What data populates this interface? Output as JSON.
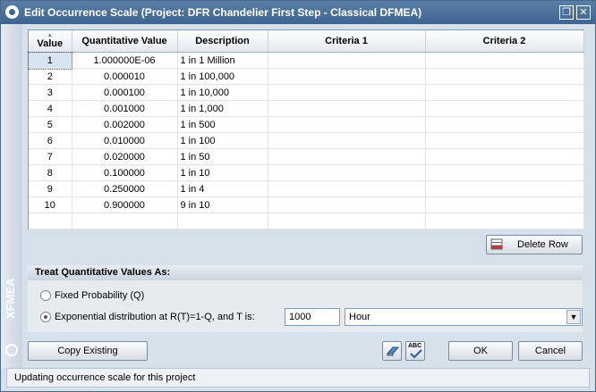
{
  "window": {
    "title": "Edit Occurrence Scale (Project: DFR Chandelier First Step - Classical DFMEA)",
    "restore_glyph": "❐",
    "close_glyph": "✕"
  },
  "sidebar": {
    "brand": "XFMEA"
  },
  "grid": {
    "columns": [
      "Value",
      "Quantitative Value",
      "Description",
      "Criteria 1",
      "Criteria 2"
    ],
    "rows": [
      {
        "value": "1",
        "quant": "1.000000E-06",
        "desc": "1 in 1 Million",
        "c1": "",
        "c2": ""
      },
      {
        "value": "2",
        "quant": "0.000010",
        "desc": "1 in 100,000",
        "c1": "",
        "c2": ""
      },
      {
        "value": "3",
        "quant": "0.000100",
        "desc": "1 in 10,000",
        "c1": "",
        "c2": ""
      },
      {
        "value": "4",
        "quant": "0.001000",
        "desc": "1 in 1,000",
        "c1": "",
        "c2": ""
      },
      {
        "value": "5",
        "quant": "0.002000",
        "desc": "1 in 500",
        "c1": "",
        "c2": ""
      },
      {
        "value": "6",
        "quant": "0.010000",
        "desc": "1 in 100",
        "c1": "",
        "c2": ""
      },
      {
        "value": "7",
        "quant": "0.020000",
        "desc": "1 in 50",
        "c1": "",
        "c2": ""
      },
      {
        "value": "8",
        "quant": "0.100000",
        "desc": "1 in 10",
        "c1": "",
        "c2": ""
      },
      {
        "value": "9",
        "quant": "0.250000",
        "desc": "1 in 4",
        "c1": "",
        "c2": ""
      },
      {
        "value": "10",
        "quant": "0.900000",
        "desc": "9 in 10",
        "c1": "",
        "c2": ""
      }
    ]
  },
  "buttons": {
    "delete_row": "Delete Row",
    "copy_existing": "Copy Existing",
    "ok": "OK",
    "cancel": "Cancel",
    "spell_abc": "ABC"
  },
  "treat": {
    "header": "Treat Quantitative Values As:",
    "option_fixed": "Fixed Probability (Q)",
    "option_exponential": "Exponential distribution at R(T)=1-Q, and T is:",
    "selected": "exponential",
    "t_value": "1000",
    "t_unit": "Hour"
  },
  "status": "Updating occurrence scale for this project"
}
